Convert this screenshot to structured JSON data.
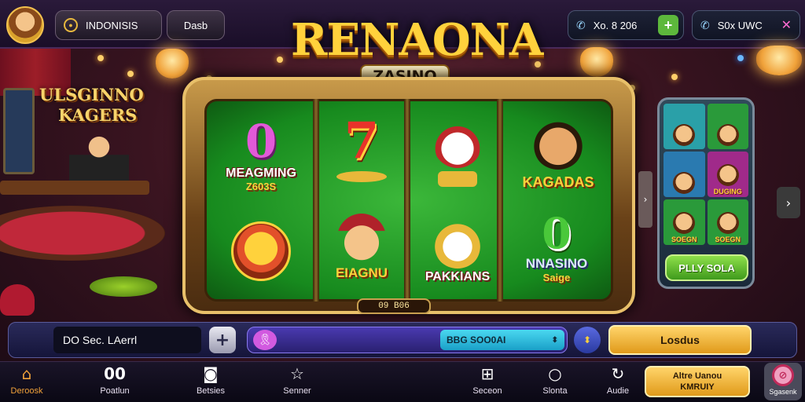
{
  "topbar": {
    "region_label": "INDONISIS",
    "lang_label": "Dasb",
    "balance_label": "Xo. 8 206",
    "coins_label": "S0x UWC"
  },
  "logo": {
    "title": "RENAONA",
    "subtitle": "ZASINO"
  },
  "left_sign": {
    "line1": "ULSGINNO",
    "line2": "KAGERS"
  },
  "reels": {
    "r1_top_glyph": "0",
    "r1_top_label": "MEAGMING",
    "r1_top_sub": "Z603S",
    "r2_top_glyph": "7",
    "r3_top_glyph": "",
    "r4_top_label": "KAGADAS",
    "r2_bottom_label": "EIAGNU",
    "r3_bottom_label": "PAKKIANS",
    "r4_bottom_glyph": "0",
    "r4_bottom_label": "NNASINO",
    "r4_bottom_sub": "Saige"
  },
  "counter": "09 B06",
  "promo": {
    "cells": [
      "",
      "",
      "",
      "DUGING",
      "SOEGN",
      "SOEGN"
    ],
    "button_label": "PLLY SOLA"
  },
  "actionbar": {
    "bet_value": "DO Sec. LAerrl",
    "select_value": "BBG SOO0AI",
    "gold_button": "Losdus"
  },
  "bottomnav": {
    "items": [
      {
        "label": "Deroosk",
        "icon": "home-icon"
      },
      {
        "label": "Poatlun",
        "glyph": "00"
      },
      {
        "label": "Betsies",
        "icon": "camera-icon"
      },
      {
        "label": "Senner",
        "icon": "star-icon"
      },
      {
        "label": "Seceon",
        "icon": "grid-icon"
      },
      {
        "label": "Slonta",
        "icon": "search-icon"
      },
      {
        "label": "Audie",
        "icon": "refresh-icon"
      }
    ],
    "promo_line1": "Altre Uanou",
    "promo_line2": "KMRUIY",
    "noads_label": "Sgasenk"
  },
  "colors": {
    "accent_gold": "#ffd23c",
    "green_reels": "#178a1e",
    "action_bar": "#2a2a5a"
  }
}
